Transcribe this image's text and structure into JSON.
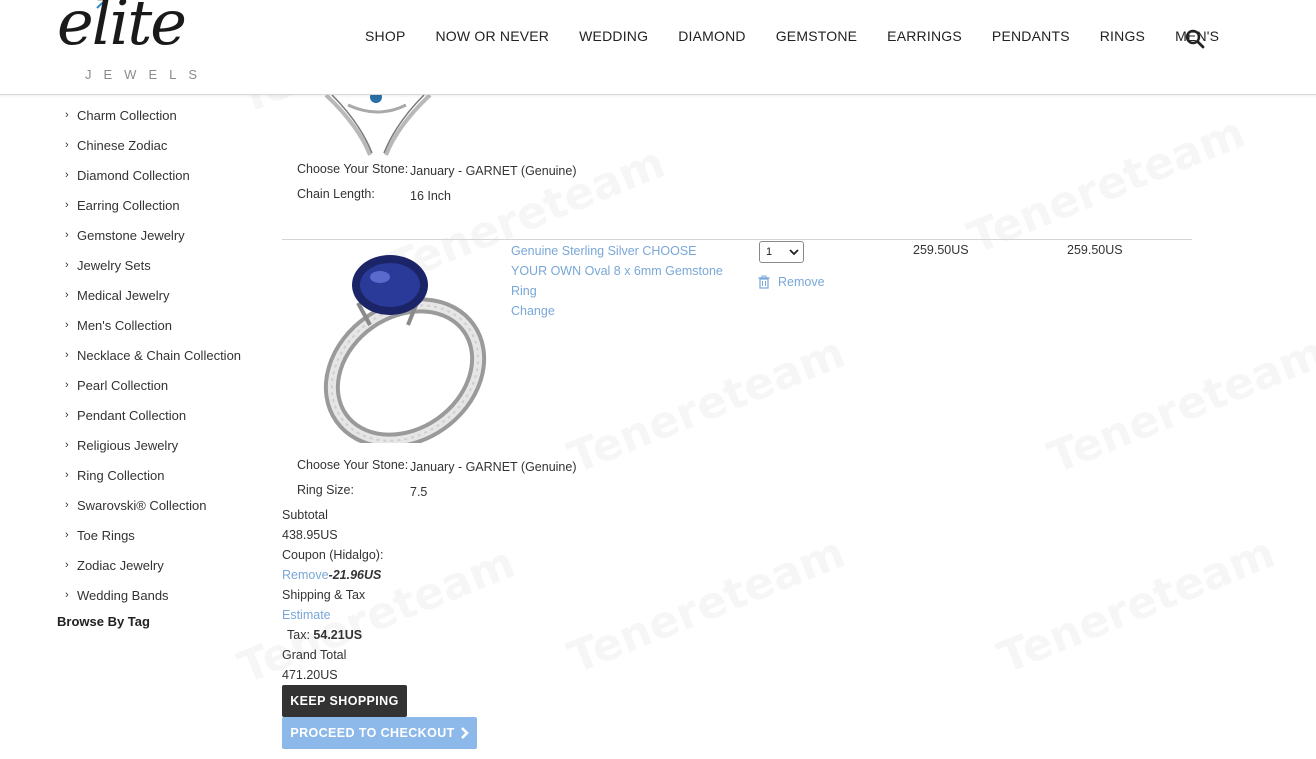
{
  "watermark": "Tenereteam",
  "brand": {
    "logo_main": "elite",
    "logo_sub": "JEWELS"
  },
  "nav": [
    "SHOP",
    "NOW OR NEVER",
    "WEDDING",
    "DIAMOND",
    "GEMSTONE",
    "EARRINGS",
    "PENDANTS",
    "RINGS",
    "MEN'S"
  ],
  "sidebar": {
    "items": [
      "Charm Collection",
      "Chinese Zodiac",
      "Diamond Collection",
      "Earring Collection",
      "Gemstone Jewelry",
      "Jewelry Sets",
      "Medical Jewelry",
      "Men's Collection",
      "Necklace & Chain Collection",
      "Pearl Collection",
      "Pendant Collection",
      "Religious Jewelry",
      "Ring Collection",
      "Swarovski® Collection",
      "Toe Rings",
      "Zodiac Jewelry",
      "Wedding Bands"
    ],
    "browse_by_tag": "Browse By Tag"
  },
  "cart": {
    "item1": {
      "opt1_label": "Choose Your Stone:",
      "opt1_value": "January - GARNET (Genuine)",
      "opt2_label": "Chain Length:",
      "opt2_value": "16 Inch"
    },
    "item2": {
      "name_line1": "Genuine Sterling Silver CHOOSE",
      "name_line2": "YOUR OWN Oval 8 x 6mm Gemstone",
      "name_line3": "Ring",
      "change": "Change",
      "qty": "1",
      "remove": "Remove",
      "unit_price": "259.50US",
      "total_price": "259.50US",
      "opt1_label": "Choose Your Stone:",
      "opt1_value": "January - GARNET (Genuine)",
      "opt2_label": "Ring Size:",
      "opt2_value": "7.5"
    },
    "totals": {
      "subtotal_label": "Subtotal",
      "subtotal": "438.95US",
      "coupon_label": "Coupon (Hidalgo):",
      "coupon_remove": "Remove",
      "coupon_amount": "-21.96US",
      "shipping_label": "Shipping & Tax",
      "estimate": "Estimate",
      "tax_label": "Tax:",
      "tax": "54.21US",
      "grand_label": "Grand Total",
      "grand_total": "471.20US"
    },
    "keep_shopping": "KEEP SHOPPING",
    "checkout": "PROCEED TO CHECKOUT"
  }
}
